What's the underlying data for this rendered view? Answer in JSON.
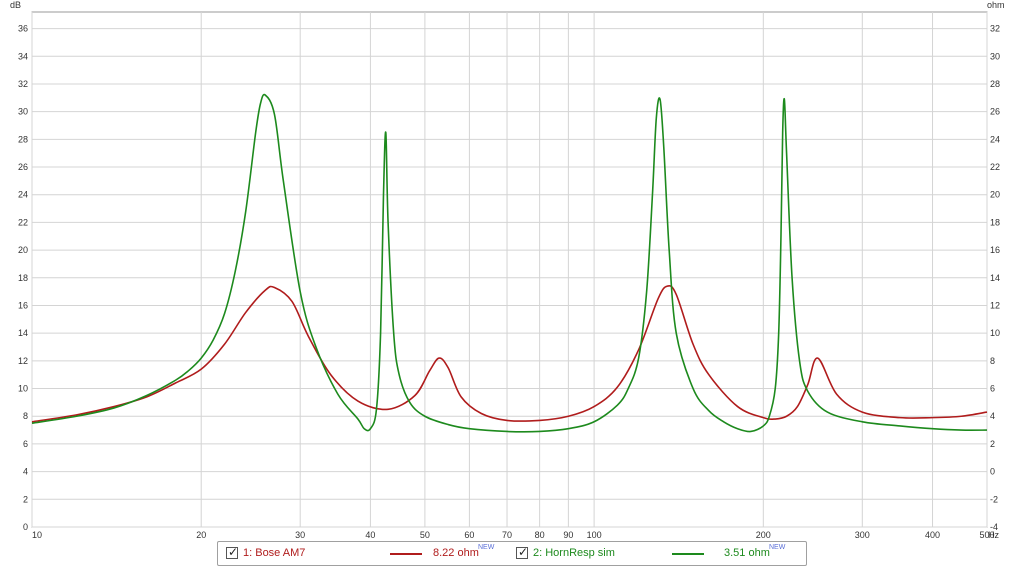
{
  "chart_data": {
    "type": "line",
    "x_scale": "log",
    "xlim": [
      10,
      500
    ],
    "ylim_left": [
      0,
      37.2
    ],
    "ylim_right": [
      -4,
      33.2
    ],
    "left_unit": "dB",
    "right_unit": "ohm",
    "x_unit": "Hz",
    "x_ticks": [
      10,
      20,
      30,
      40,
      50,
      60,
      70,
      80,
      90,
      100,
      200,
      300,
      400,
      500
    ],
    "x_tick_labels": [
      "10",
      "20",
      "30",
      "40",
      "50",
      "60",
      "70",
      "80",
      "90",
      "100",
      "200",
      "300",
      "400",
      "500"
    ],
    "y_ticks_left": [
      0,
      2,
      4,
      6,
      8,
      10,
      12,
      14,
      16,
      18,
      20,
      22,
      24,
      26,
      28,
      30,
      32,
      34,
      36
    ],
    "y_ticks_right": [
      -4,
      -2,
      0,
      2,
      4,
      6,
      8,
      10,
      12,
      14,
      16,
      18,
      20,
      22,
      24,
      26,
      28,
      30,
      32
    ],
    "grid": true,
    "legend_placement": "bottom",
    "series": [
      {
        "name": "1: Bose AM7",
        "value_label": "8.22 ohm",
        "color": "#b01c1c",
        "x": [
          10,
          12,
          14,
          16,
          18,
          20,
          22,
          24,
          26,
          27,
          29,
          31,
          34,
          38,
          43,
          48,
          51,
          53,
          55,
          58,
          63,
          70,
          80,
          90,
          100,
          110,
          120,
          130,
          135,
          140,
          150,
          160,
          180,
          200,
          210,
          220,
          230,
          240,
          250,
          270,
          300,
          350,
          400,
          450,
          500
        ],
        "y": [
          7.6,
          8.1,
          8.7,
          9.4,
          10.4,
          11.4,
          13.2,
          15.5,
          17.1,
          17.3,
          16.3,
          13.8,
          11.0,
          9.1,
          8.5,
          9.5,
          11.3,
          12.2,
          11.5,
          9.4,
          8.2,
          7.7,
          7.7,
          8.0,
          8.7,
          10.1,
          12.8,
          16.5,
          17.4,
          16.8,
          13.2,
          11.0,
          8.7,
          7.9,
          7.8,
          8.0,
          8.7,
          10.3,
          12.2,
          9.6,
          8.3,
          7.9,
          7.9,
          8.0,
          8.3
        ]
      },
      {
        "name": "2: HornResp sim",
        "value_label": "3.51 ohm",
        "color": "#1d8a1d",
        "x": [
          10,
          12,
          14,
          16,
          18,
          19,
          20,
          21,
          22,
          23,
          24,
          25,
          25.5,
          26,
          27,
          28,
          30,
          32,
          35,
          38,
          39,
          40,
          41,
          41.7,
          42.2,
          42.6,
          43,
          44,
          45,
          47,
          50,
          55,
          60,
          70,
          80,
          90,
          100,
          110,
          115,
          120,
          124,
          127,
          129,
          131,
          133,
          136,
          140,
          150,
          160,
          170,
          180,
          190,
          200,
          205,
          210,
          213,
          215,
          216.5,
          218,
          220,
          225,
          232,
          240,
          260,
          300,
          350,
          400,
          450,
          500
        ],
        "y": [
          7.5,
          8.0,
          8.6,
          9.5,
          10.6,
          11.3,
          12.2,
          13.5,
          15.4,
          18.5,
          22.8,
          28.5,
          30.6,
          31.2,
          29.8,
          25.0,
          17.0,
          13.0,
          9.6,
          7.8,
          7.1,
          7.1,
          8.5,
          14.0,
          24.0,
          28.5,
          22.0,
          14.0,
          11.0,
          9.0,
          8.0,
          7.4,
          7.1,
          6.9,
          6.9,
          7.1,
          7.6,
          8.8,
          10.0,
          12.2,
          17.0,
          24.0,
          29.5,
          30.9,
          27.5,
          20.0,
          14.0,
          10.0,
          8.4,
          7.6,
          7.1,
          6.9,
          7.3,
          8.0,
          10.0,
          14.0,
          21.0,
          28.5,
          30.9,
          27.0,
          18.0,
          12.0,
          9.8,
          8.3,
          7.6,
          7.3,
          7.1,
          7.0,
          7.0
        ]
      }
    ]
  }
}
